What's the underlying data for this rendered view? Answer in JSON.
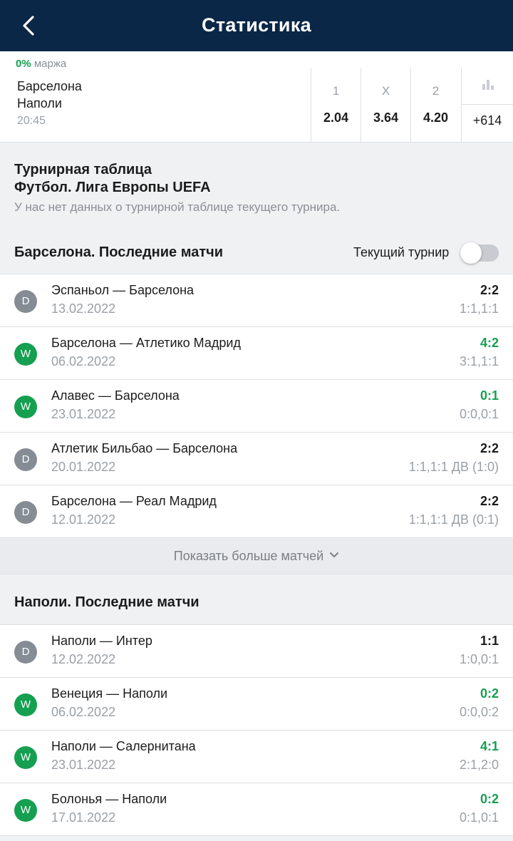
{
  "header": {
    "title": "Статистика"
  },
  "event": {
    "margin_value": "0%",
    "margin_label": "маржа",
    "team1": "Барселона",
    "team2": "Наполи",
    "time": "20:45",
    "odds": [
      {
        "label": "1",
        "value": "2.04"
      },
      {
        "label": "X",
        "value": "3.64"
      },
      {
        "label": "2",
        "value": "4.20"
      }
    ],
    "more_count": "+614"
  },
  "standings": {
    "title": "Турнирная таблица",
    "tournament": "Футбол. Лига Европы UEFA",
    "note": "У нас нет данных о турнирной таблице текущего турнира."
  },
  "team1_section": {
    "title": "Барселона. Последние матчи",
    "toggle_label": "Текущий турнир",
    "toggle_on": false,
    "matches": [
      {
        "result": "D",
        "teams": "Эспаньол — Барселона",
        "date": "13.02.2022",
        "score": "2:2",
        "detail": "1:1,1:1"
      },
      {
        "result": "W",
        "teams": "Барселона — Атлетико Мадрид",
        "date": "06.02.2022",
        "score": "4:2",
        "detail": "3:1,1:1"
      },
      {
        "result": "W",
        "teams": "Алавес — Барселона",
        "date": "23.01.2022",
        "score": "0:1",
        "detail": "0:0,0:1"
      },
      {
        "result": "D",
        "teams": "Атлетик Бильбао — Барселона",
        "date": "20.01.2022",
        "score": "2:2",
        "detail": "1:1,1:1 ДВ (1:0)"
      },
      {
        "result": "D",
        "teams": "Барселона — Реал Мадрид",
        "date": "12.01.2022",
        "score": "2:2",
        "detail": "1:1,1:1 ДВ (0:1)"
      }
    ],
    "show_more": "Показать больше матчей"
  },
  "team2_section": {
    "title": "Наполи. Последние матчи",
    "matches": [
      {
        "result": "D",
        "teams": "Наполи — Интер",
        "date": "12.02.2022",
        "score": "1:1",
        "detail": "1:0,0:1"
      },
      {
        "result": "W",
        "teams": "Венеция — Наполи",
        "date": "06.02.2022",
        "score": "0:2",
        "detail": "0:0,0:2"
      },
      {
        "result": "W",
        "teams": "Наполи — Салернитана",
        "date": "23.01.2022",
        "score": "4:1",
        "detail": "2:1,2:0"
      },
      {
        "result": "W",
        "teams": "Болонья — Наполи",
        "date": "17.01.2022",
        "score": "0:2",
        "detail": "0:1,0:1"
      }
    ]
  },
  "colors": {
    "header_bg": "#0b2747",
    "win": "#14a050",
    "draw": "#858c94"
  }
}
